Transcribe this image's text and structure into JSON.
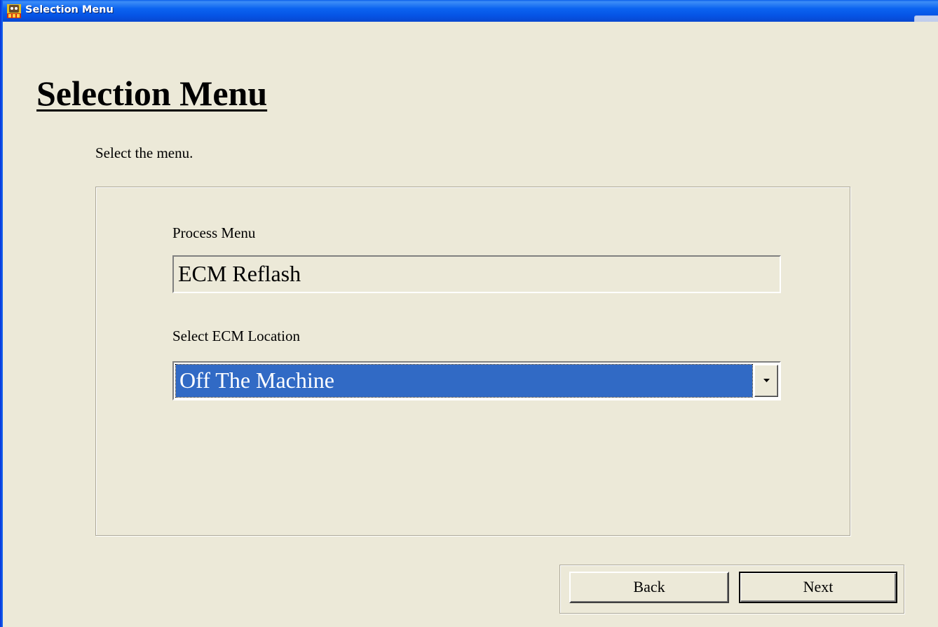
{
  "window": {
    "title": "Selection Menu",
    "app_icon": "machine-app-icon",
    "close_icon": "close-icon"
  },
  "page": {
    "title": "Selection Menu",
    "instruction": "Select the menu."
  },
  "process_menu": {
    "label": "Process Menu",
    "value": "ECM Reflash"
  },
  "ecm_location": {
    "label": "Select ECM Location",
    "selected": "Off The Machine",
    "dropdown_icon": "chevron-down-icon"
  },
  "buttons": {
    "back": "Back",
    "next": "Next"
  },
  "colors": {
    "titlebar": "#0B63F0",
    "background": "#ECE9D8",
    "selection": "#316AC5"
  }
}
